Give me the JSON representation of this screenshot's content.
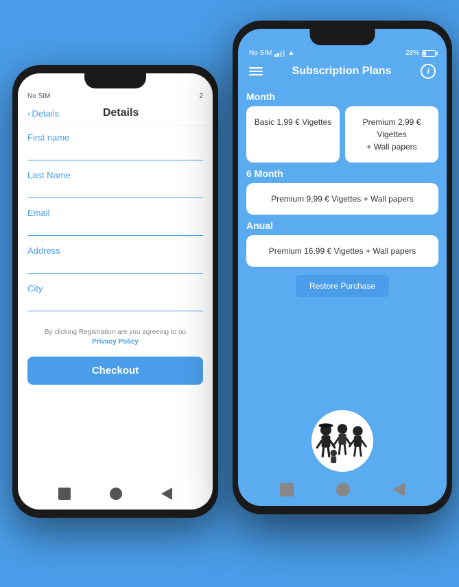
{
  "background_color": "#4a9de8",
  "phone1": {
    "status": {
      "left": "No SIM",
      "right": "2"
    },
    "nav": {
      "back_label": "Details",
      "title": "Details"
    },
    "fields": [
      {
        "label": "First name",
        "value": ""
      },
      {
        "label": "Last Name",
        "value": ""
      },
      {
        "label": "Email",
        "value": ""
      },
      {
        "label": "Address",
        "value": ""
      },
      {
        "label": "City",
        "value": ""
      }
    ],
    "privacy_text": "By clicking Registration are you agreeing to ou",
    "privacy_link": "Privacy Policy",
    "checkout_label": "Checkout"
  },
  "phone2": {
    "status": {
      "left": "No SIM",
      "wifi": "▲",
      "battery_pct": "28%"
    },
    "header": {
      "title": "Subscription Plans",
      "menu_icon": "≡",
      "info_icon": "i"
    },
    "sections": [
      {
        "label": "Month",
        "plans": [
          {
            "text": "Basic 1,99 € Vigettes"
          },
          {
            "text": "Premium 2,99 € Vigettes\n+ Wall papers"
          }
        ],
        "single": false
      },
      {
        "label": "6 Month",
        "plans": [
          {
            "text": "Premium 9,99 € Vigettes + Wall papers"
          }
        ],
        "single": true
      },
      {
        "label": "Anual",
        "plans": [
          {
            "text": "Premium 16,99 € Vigettes + Wall papers"
          }
        ],
        "single": true
      }
    ],
    "restore_button_label": "Restore Purchase"
  }
}
